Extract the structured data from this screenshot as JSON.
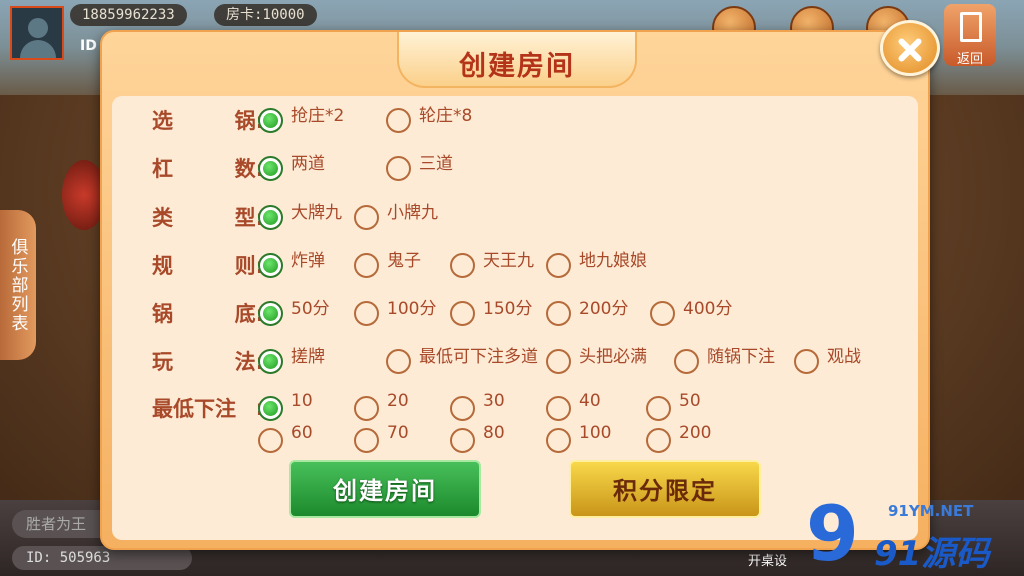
{
  "header": {
    "phone": "18859962233",
    "room_card": "房卡:10000",
    "id_label": "ID",
    "back_label": "返回"
  },
  "side_tab": {
    "label": "俱乐部列表"
  },
  "bottom": {
    "input_placeholder": "胜者为王",
    "id_text": "ID: 505963",
    "setting_text": "开桌设"
  },
  "dialog": {
    "title": "创建房间",
    "rows": [
      {
        "label": [
          "选",
          "锅:"
        ],
        "options": [
          {
            "text": "抢庄*2",
            "selected": true
          },
          {
            "text": "轮庄*8",
            "selected": false
          }
        ]
      },
      {
        "label": [
          "杠",
          "数:"
        ],
        "options": [
          {
            "text": "两道",
            "selected": true
          },
          {
            "text": "三道",
            "selected": false
          }
        ]
      },
      {
        "label": [
          "类",
          "型:"
        ],
        "options": [
          {
            "text": "大牌九",
            "selected": true
          },
          {
            "text": "小牌九",
            "selected": false
          }
        ]
      },
      {
        "label": [
          "规",
          "则:"
        ],
        "options": [
          {
            "text": "炸弹",
            "selected": true
          },
          {
            "text": "鬼子",
            "selected": false
          },
          {
            "text": "天王九",
            "selected": false
          },
          {
            "text": "地九娘娘",
            "selected": false
          }
        ]
      },
      {
        "label": [
          "锅",
          "底:"
        ],
        "options": [
          {
            "text": "50分",
            "selected": true
          },
          {
            "text": "100分",
            "selected": false
          },
          {
            "text": "150分",
            "selected": false
          },
          {
            "text": "200分",
            "selected": false
          },
          {
            "text": "400分",
            "selected": false
          }
        ]
      },
      {
        "label": [
          "玩",
          "法:"
        ],
        "options": [
          {
            "text": "搓牌",
            "selected": true
          },
          {
            "text": "最低可下注多道",
            "selected": false
          },
          {
            "text": "头把必满",
            "selected": false
          },
          {
            "text": "随锅下注",
            "selected": false
          },
          {
            "text": "观战",
            "selected": false
          }
        ]
      },
      {
        "label": [
          "最低下注",
          ":"
        ],
        "options": [
          {
            "text": "10",
            "selected": true
          },
          {
            "text": "20",
            "selected": false
          },
          {
            "text": "30",
            "selected": false
          },
          {
            "text": "40",
            "selected": false
          },
          {
            "text": "50",
            "selected": false
          }
        ]
      },
      {
        "label": [
          "",
          ""
        ],
        "options": [
          {
            "text": "60",
            "selected": false
          },
          {
            "text": "70",
            "selected": false
          },
          {
            "text": "80",
            "selected": false
          },
          {
            "text": "100",
            "selected": false
          },
          {
            "text": "200",
            "selected": false
          }
        ]
      }
    ],
    "create_button": "创建房间",
    "score_limit_button": "积分限定"
  },
  "watermark": {
    "top": "91YM.NET",
    "main": "91源码",
    "nine": "9"
  },
  "colors": {
    "label": "#a84a2a",
    "radio_on": "#1f9a1f",
    "dialog_bg": "#fdebd6",
    "title": "#b4341a"
  }
}
